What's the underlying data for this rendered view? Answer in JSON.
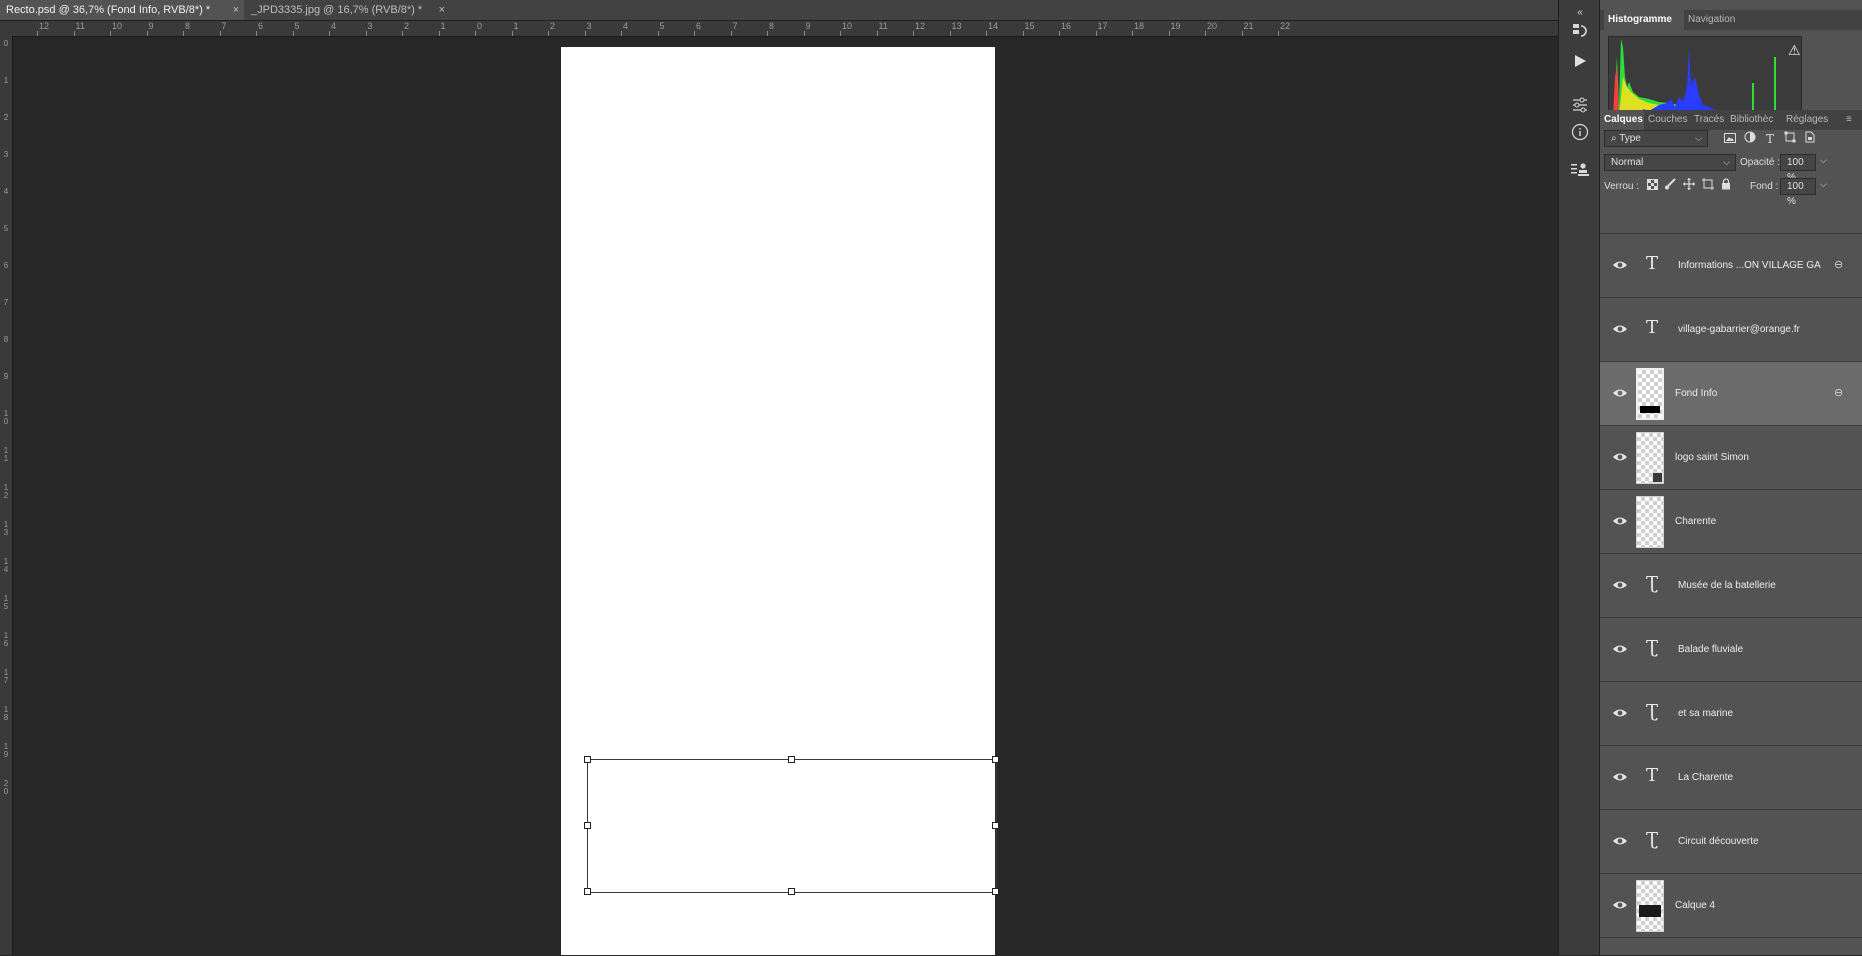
{
  "doc_tabs": [
    {
      "label": "Recto.psd @ 36,7% (Fond Info, RVB/8*) *",
      "active": true
    },
    {
      "label": "_JPD3335.jpg @ 16,7% (RVB/8*) *",
      "active": false
    }
  ],
  "close_glyph": "×",
  "ruler_top_labels": [
    "12",
    "11",
    "10",
    "9",
    "8",
    "7",
    "6",
    "5",
    "4",
    "3",
    "2",
    "1",
    "0",
    "1",
    "2",
    "3",
    "4",
    "5",
    "6",
    "7",
    "8",
    "9",
    "10",
    "11",
    "12",
    "13",
    "14",
    "15",
    "16",
    "17",
    "18",
    "19",
    "20",
    "21",
    "22"
  ],
  "ruler_left_labels": [
    "0",
    "1",
    "2",
    "3",
    "4",
    "5",
    "6",
    "7",
    "8",
    "9",
    "1 0",
    "1 1",
    "1 2",
    "1 3",
    "1 4",
    "1 5",
    "1 6",
    "1 7",
    "1 8",
    "1 9",
    "2 0"
  ],
  "histogram_panel": {
    "tabs": [
      "Histogramme",
      "Navigation"
    ],
    "warning_icon": "⚠"
  },
  "layers_panel": {
    "tabs": [
      "Calques",
      "Couches",
      "Tracés",
      "Bibliothèc",
      "Réglages"
    ],
    "filter_kind": "Type",
    "blend_mode": "Normal",
    "opacity_label": "Opacité :",
    "opacity_value": "100 %",
    "lock_label": "Verrou :",
    "fill_label": "Fond :",
    "fill_value": "100 %",
    "layers": [
      {
        "name": "Informations ...ON VILLAGE GA",
        "kind": "text",
        "linked": true,
        "selected": false
      },
      {
        "name": "village-gabarrier@orange.fr",
        "kind": "text",
        "linked": false,
        "selected": false
      },
      {
        "name": "Fond Info",
        "kind": "pixel",
        "linked": true,
        "selected": true
      },
      {
        "name": "logo saint Simon",
        "kind": "smart",
        "linked": false,
        "selected": false
      },
      {
        "name": "Charente",
        "kind": "pixel",
        "linked": false,
        "selected": false
      },
      {
        "name": "Musée de la batellerie",
        "kind": "warped-text",
        "linked": false,
        "selected": false
      },
      {
        "name": "Balade fluviale",
        "kind": "warped-text",
        "linked": false,
        "selected": false
      },
      {
        "name": "et sa marine",
        "kind": "warped-text",
        "linked": false,
        "selected": false
      },
      {
        "name": "La Charente",
        "kind": "text",
        "linked": false,
        "selected": false
      },
      {
        "name": "Circuit découverte",
        "kind": "warped-text",
        "linked": false,
        "selected": false
      },
      {
        "name": "Calque 4",
        "kind": "image",
        "linked": false,
        "selected": false
      }
    ]
  },
  "tool_strip_icons": [
    "history-icon",
    "play-icon",
    "adjustments-icon",
    "info-icon",
    "clone-source-icon"
  ]
}
